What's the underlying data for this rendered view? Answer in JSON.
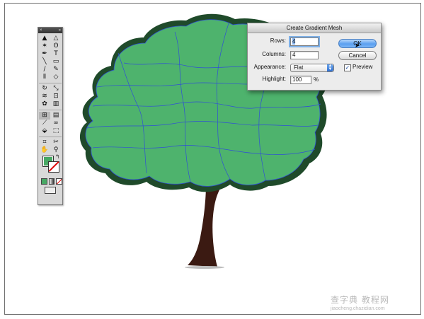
{
  "dialog": {
    "title": "Create Gradient Mesh",
    "rows_label": "Rows:",
    "rows_value": "4",
    "columns_label": "Columns:",
    "columns_value": "4",
    "appearance_label": "Appearance:",
    "appearance_value": "Flat",
    "highlight_label": "Highlight:",
    "highlight_value": "100",
    "highlight_unit": "%",
    "ok_label": "OK",
    "cancel_label": "Cancel",
    "preview_label": "Preview",
    "preview_checked": true
  },
  "tools_panel": {
    "tools": [
      {
        "name": "selection-tool-icon",
        "glyph": "▲"
      },
      {
        "name": "direct-selection-tool-icon",
        "glyph": "△"
      },
      {
        "name": "magic-wand-tool-icon",
        "glyph": "✶"
      },
      {
        "name": "lasso-tool-icon",
        "glyph": "ʘ"
      },
      {
        "name": "pen-tool-icon",
        "glyph": "✒"
      },
      {
        "name": "type-tool-icon",
        "glyph": "T"
      },
      {
        "name": "line-tool-icon",
        "glyph": "╲"
      },
      {
        "name": "rectangle-tool-icon",
        "glyph": "▭"
      },
      {
        "name": "paintbrush-tool-icon",
        "glyph": "∕"
      },
      {
        "name": "pencil-tool-icon",
        "glyph": "✎"
      },
      {
        "name": "blob-brush-tool-icon",
        "glyph": "⦀"
      },
      {
        "name": "eraser-tool-icon",
        "glyph": "◇"
      },
      {
        "name": "rotate-tool-icon",
        "glyph": "↻"
      },
      {
        "name": "scale-tool-icon",
        "glyph": "⤡"
      },
      {
        "name": "warp-tool-icon",
        "glyph": "≋"
      },
      {
        "name": "free-transform-tool-icon",
        "glyph": "⊡"
      },
      {
        "name": "symbol-sprayer-tool-icon",
        "glyph": "✿"
      },
      {
        "name": "column-graph-tool-icon",
        "glyph": "▥"
      },
      {
        "name": "mesh-tool-icon",
        "glyph": "⊞"
      },
      {
        "name": "gradient-tool-icon",
        "glyph": "▤"
      },
      {
        "name": "eyedropper-tool-icon",
        "glyph": "⟋"
      },
      {
        "name": "blend-tool-icon",
        "glyph": "∞"
      },
      {
        "name": "live-paint-bucket-tool-icon",
        "glyph": "⬙"
      },
      {
        "name": "live-paint-selection-tool-icon",
        "glyph": "⬚"
      },
      {
        "name": "slice-tool-icon",
        "glyph": "⌗"
      },
      {
        "name": "scissors-tool-icon",
        "glyph": "✂"
      },
      {
        "name": "hand-tool-icon",
        "glyph": "✋"
      },
      {
        "name": "zoom-tool-icon",
        "glyph": "⚲"
      }
    ],
    "active_tool_index": 18,
    "fill_color": "#47a864",
    "stroke_color": "#ffffff"
  },
  "artwork": {
    "foliage_color": "#4eb36d",
    "foliage_shadow_color": "#1f4a2a",
    "mesh_line_color": "#2f4fd6",
    "trunk_color": "#3b1a12"
  },
  "watermark": {
    "main": "查字典 教程网",
    "sub": "jiaocheng.chazidian.com"
  }
}
